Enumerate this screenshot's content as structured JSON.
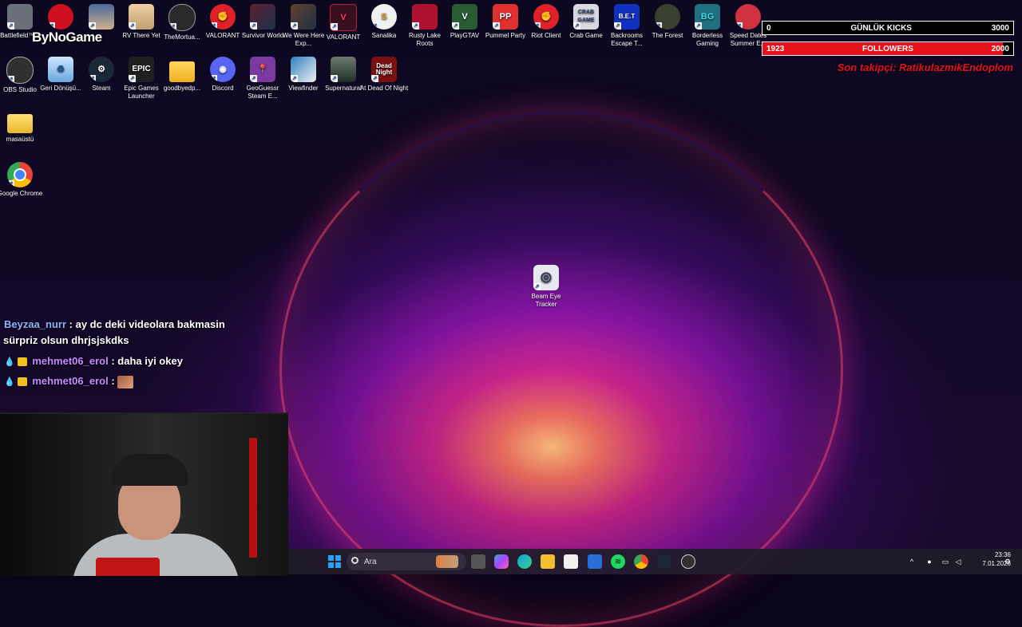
{
  "overlay": {
    "brand": "ByNoGame",
    "kicks_bar": {
      "left": "0",
      "label": "GÜNLÜK KICKS",
      "right": "3000",
      "progress": 0
    },
    "followers_bar": {
      "left": "1923",
      "label": "FOLLOWERS",
      "right": "2000",
      "progress": 0.96
    },
    "last_follower": "Son takipçi: RatikulazmikEndoplom"
  },
  "chat": [
    {
      "user": "Beyzaa_nurr",
      "message": ": ay dc deki videolara bakmasin",
      "continuation": "sürpriz olsun dhrjsjskdks"
    },
    {
      "user": "mehmet06_erol",
      "message": ": daha iyi okey"
    },
    {
      "user": "mehmet06_erol",
      "message": ":"
    }
  ],
  "desktop_icons": [
    {
      "label": "Battlefield™ 6",
      "icon": "battlefield-icon",
      "color": "#6b6f7a"
    },
    {
      "label": "",
      "icon": "red-mask-icon",
      "color": "#d01020"
    },
    {
      "label": "",
      "icon": "game-cover-icon",
      "color": "#4a6a9a"
    },
    {
      "label": "RV There Yet",
      "icon": "rv-game-icon",
      "color": "#c0a070"
    },
    {
      "label": "TheMortua...",
      "icon": "mortuary-icon",
      "color": "#2a2a2a"
    },
    {
      "label": "VALORANT",
      "icon": "riot-fist-icon",
      "color": "#e0202a"
    },
    {
      "label": "Survivor World",
      "icon": "survivor-icon",
      "color": "#5a2030"
    },
    {
      "label": "We Were Here Exp...",
      "icon": "we-were-here-icon",
      "color": "#604030"
    },
    {
      "label": "VALORANT",
      "icon": "valorant-icon",
      "color": "#c0203a"
    },
    {
      "label": "Sanalika",
      "icon": "sanalika-icon",
      "color": "#f0f0f0"
    },
    {
      "label": "Rusty Lake Roots",
      "icon": "rusty-lake-icon",
      "color": "#b01030"
    },
    {
      "label": "PlayGTAV",
      "icon": "gta-icon",
      "color": "#2a5a30"
    },
    {
      "label": "Pummel Party",
      "icon": "pummel-party-icon",
      "color": "#e03030"
    },
    {
      "label": "Riot Client",
      "icon": "riot-client-icon",
      "color": "#e0202a"
    },
    {
      "label": "Crab Game",
      "icon": "crab-game-icon",
      "color": "#d8d8e0"
    },
    {
      "label": "Backrooms Escape T...",
      "icon": "backrooms-icon",
      "color": "#1030c0"
    },
    {
      "label": "The Forest",
      "icon": "forest-icon",
      "color": "#3a4030"
    },
    {
      "label": "Borderless Gaming",
      "icon": "borderless-icon",
      "color": "#207080"
    },
    {
      "label": "Speed Dates Summer E...",
      "icon": "speed-dates-icon",
      "color": "#d03040"
    },
    {
      "label": "OBS Studio",
      "icon": "obs-icon",
      "color": "#303030"
    },
    {
      "label": "Geri Dönüşü...",
      "icon": "recycle-bin-icon",
      "color": "#6aa8e0"
    },
    {
      "label": "Steam",
      "icon": "steam-icon",
      "color": "#1b2838"
    },
    {
      "label": "Epic Games Launcher",
      "icon": "epic-games-icon",
      "color": "#202020"
    },
    {
      "label": "goodbyedp...",
      "icon": "folder-icon",
      "color": "#f0c040"
    },
    {
      "label": "Discord",
      "icon": "discord-icon",
      "color": "#5865f2"
    },
    {
      "label": "GeoGuessr Steam E...",
      "icon": "geoguessr-icon",
      "color": "#7a3aa0"
    },
    {
      "label": "Viewfinder",
      "icon": "viewfinder-icon",
      "color": "#3080c0"
    },
    {
      "label": "Supernatural",
      "icon": "supernatural-icon",
      "color": "#405048"
    },
    {
      "label": "At Dead Of Night",
      "icon": "dead-of-night-icon",
      "color": "#7a1010"
    },
    {
      "label": "masaüstü",
      "icon": "folder-icon",
      "color": "#e8c050"
    },
    {
      "label": "Google Chrome",
      "icon": "chrome-icon",
      "color": "#ffffff"
    },
    {
      "label": "Beam Eye Tracker",
      "icon": "beam-eye-icon",
      "color": "#e8e8f0"
    }
  ],
  "tile_text": {
    "epic": "EPIC",
    "crab": "CRAB GAME",
    "bet": "B.E.T",
    "bg": "BG",
    "dead": "Dead Night"
  },
  "taskbar": {
    "search_label": "Ara",
    "time": "23:36",
    "date": "7.01.2026"
  }
}
